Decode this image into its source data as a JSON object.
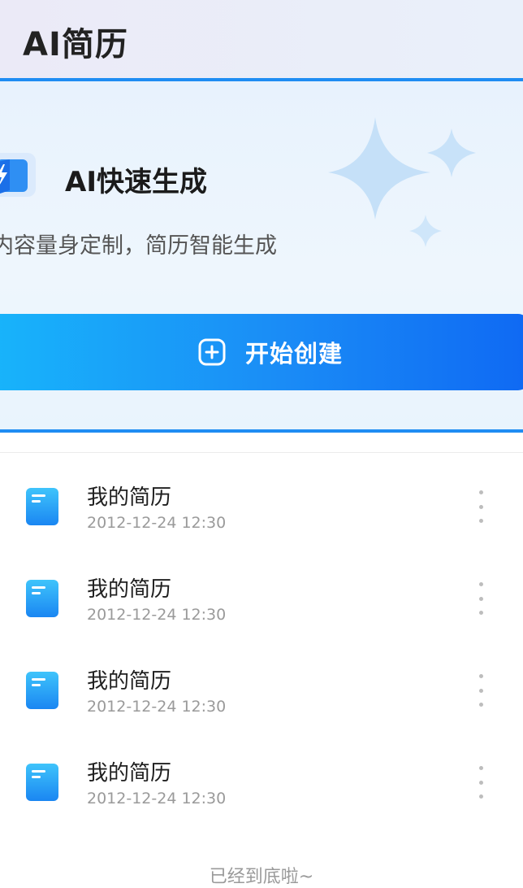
{
  "header": {
    "title": "AI简历"
  },
  "hero": {
    "title": "AI快速生成",
    "subtitle": "内容量身定制，简历智能生成",
    "button_label": "开始创建",
    "icons": {
      "logo": "ai-lightning-logo",
      "sparkles": "sparkle-stars",
      "button": "plus-square-icon"
    }
  },
  "resumes": [
    {
      "title": "我的简历",
      "date": "2012-12-24 12:30"
    },
    {
      "title": "我的简历",
      "date": "2012-12-24 12:30"
    },
    {
      "title": "我的简历",
      "date": "2012-12-24 12:30"
    },
    {
      "title": "我的简历",
      "date": "2012-12-24 12:30"
    }
  ],
  "footer": {
    "end_text": "已经到底啦~"
  },
  "colors": {
    "accent": "#1a8cf6",
    "accent_light": "#18b6fb",
    "accent_dark": "#0f69f3"
  }
}
